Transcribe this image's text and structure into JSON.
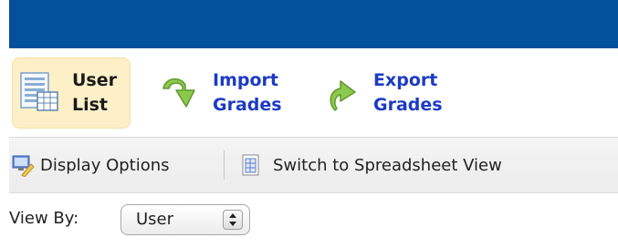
{
  "toolbar": {
    "user_list_label": "User\nList",
    "import_label": "Import\nGrades",
    "export_label": "Export\nGrades"
  },
  "subbar": {
    "display_options": "Display Options",
    "switch_view": "Switch to Spreadsheet View"
  },
  "view_by": {
    "label": "View By:",
    "selected": "User"
  },
  "colors": {
    "header_blue": "#03509c",
    "link_blue": "#1c3bc4",
    "active_bg": "#fdf0c8",
    "green_icon": "#8cc84b"
  },
  "icons": {
    "user_list": "list-table-icon",
    "import": "import-arrow-icon",
    "export": "export-arrow-icon",
    "display_options": "display-options-icon",
    "spreadsheet": "spreadsheet-icon",
    "select_arrows": "updown-arrows-icon"
  }
}
